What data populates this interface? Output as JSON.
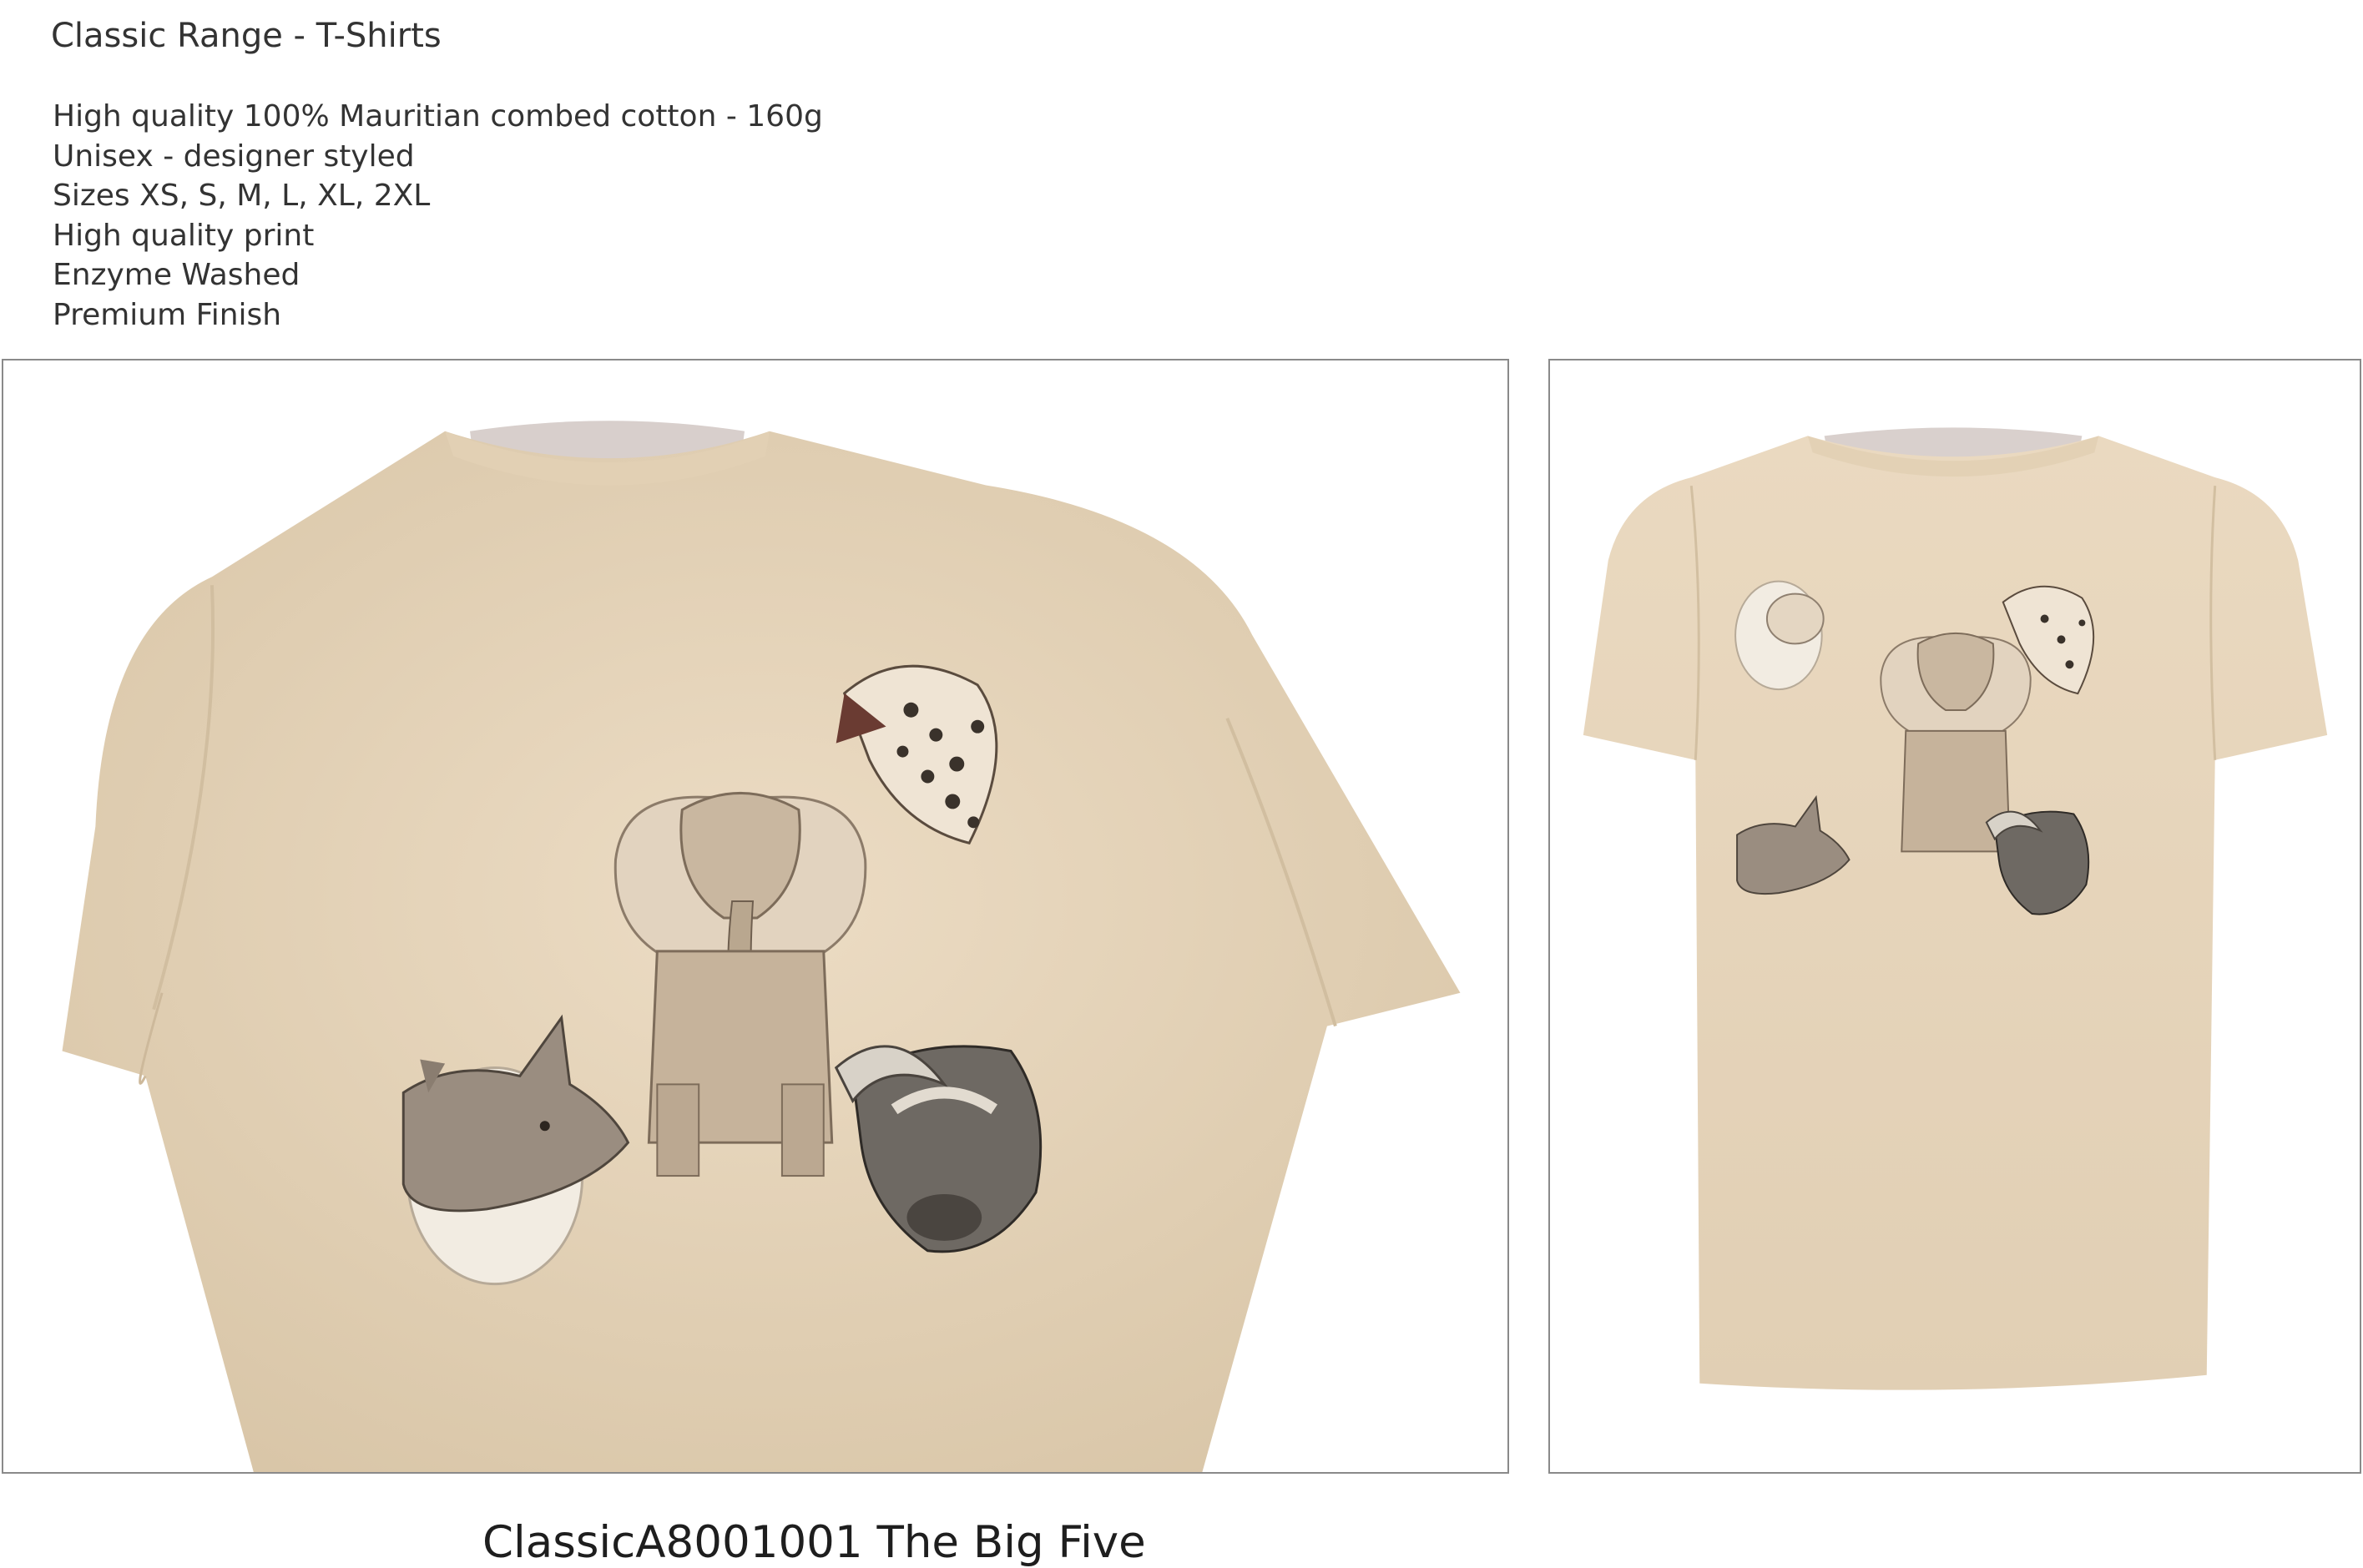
{
  "header": {
    "title": "Classic Range - T-Shirts"
  },
  "features": [
    "High quality 100% Mauritian combed cotton - 160g",
    "Unisex - designer styled",
    "Sizes XS, S, M, L, XL, 2XL",
    "High quality print",
    "Enzyme Washed",
    "Premium Finish"
  ],
  "product": {
    "caption": "ClassicA8001001 The Big Five",
    "shirt_color": "#e8d8c0",
    "print_animals": [
      "lion",
      "leopard",
      "elephant",
      "rhino",
      "buffalo"
    ]
  }
}
